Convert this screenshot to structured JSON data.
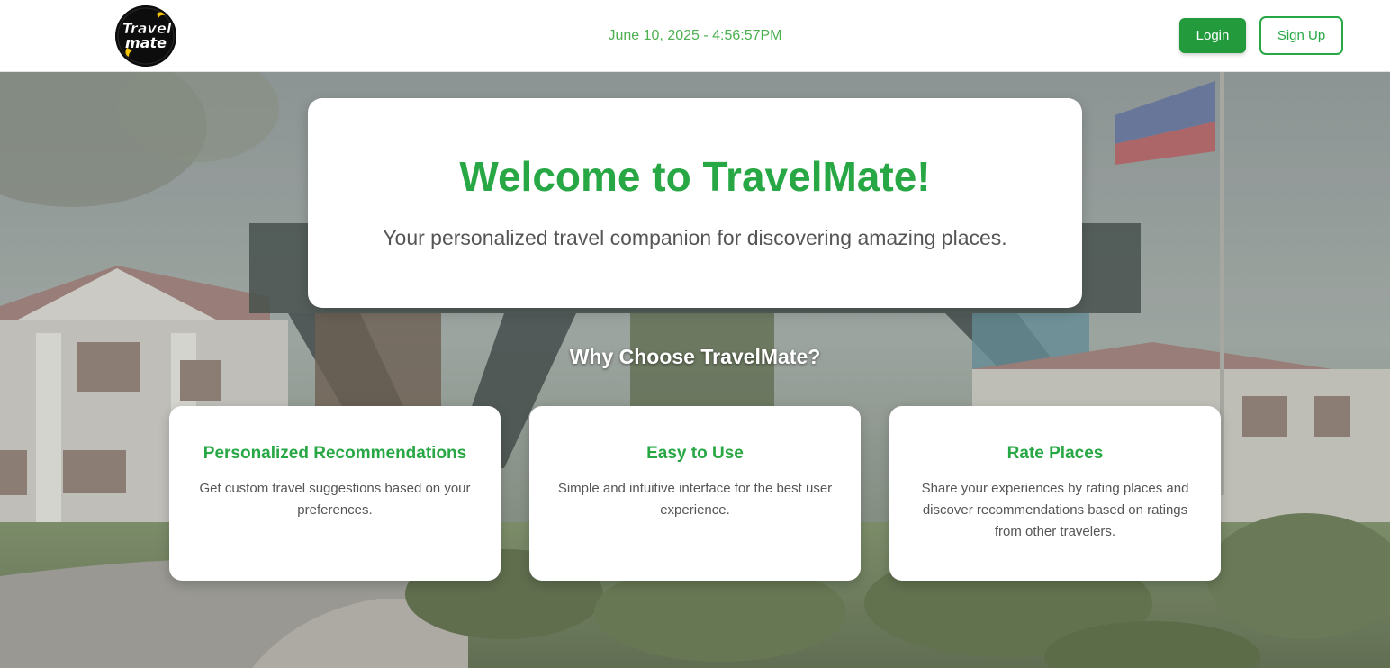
{
  "header": {
    "logo_text_line1": "Travel",
    "logo_text_line2": "mate",
    "datetime": "June 10, 2025 - 4:56:57PM",
    "login_label": "Login",
    "signup_label": "Sign Up"
  },
  "welcome": {
    "title": "Welcome to TravelMate!",
    "subtitle": "Your personalized travel companion for discovering amazing places."
  },
  "why": {
    "title": "Why Choose TravelMate?"
  },
  "features": [
    {
      "title": "Personalized Recommendations",
      "description": "Get custom travel suggestions based on your preferences."
    },
    {
      "title": "Easy to Use",
      "description": "Simple and intuitive interface for the best user experience."
    },
    {
      "title": "Rate Places",
      "description": "Share your experiences by rating places and discover recommendations based on ratings from other travelers."
    }
  ],
  "colors": {
    "brand_green": "#28a745",
    "login_button": "#239b3d",
    "datetime_text": "#4caf50"
  }
}
